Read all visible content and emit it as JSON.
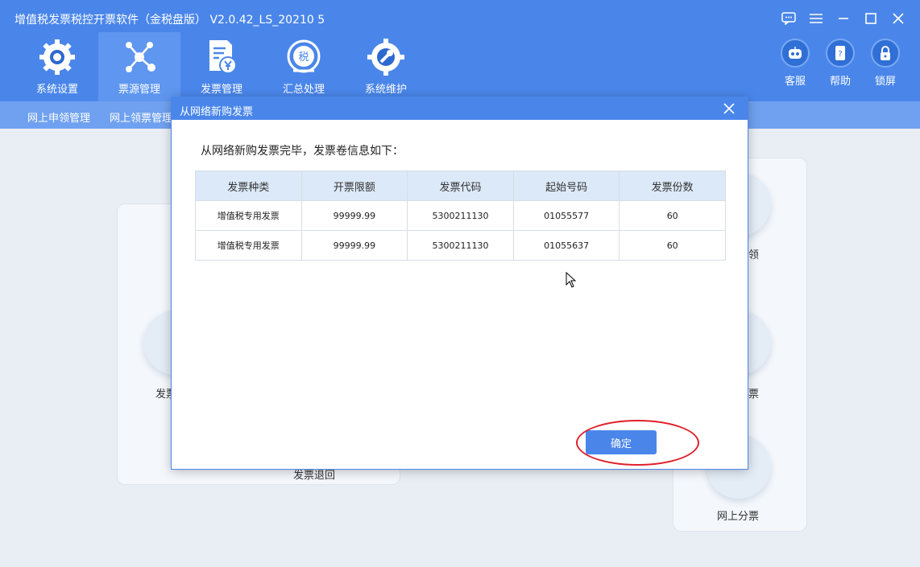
{
  "window": {
    "title": "增值税发票税控开票软件（金税盘版） V2.0.42_LS_20210 5",
    "controls": [
      "feedback-icon",
      "menu-icon",
      "minimize-icon",
      "maximize-icon",
      "close-icon"
    ]
  },
  "nav": {
    "items": [
      {
        "label": "系统设置",
        "icon": "gear-icon"
      },
      {
        "label": "票源管理",
        "icon": "network-icon",
        "active": true
      },
      {
        "label": "发票管理",
        "icon": "invoice-yen-icon"
      },
      {
        "label": "汇总处理",
        "icon": "tax-summary-icon"
      },
      {
        "label": "系统维护",
        "icon": "wrench-gear-icon"
      }
    ]
  },
  "tools": {
    "items": [
      {
        "label": "客服",
        "icon": "robot-icon"
      },
      {
        "label": "帮助",
        "icon": "help-book-icon"
      },
      {
        "label": "锁屏",
        "icon": "lock-icon"
      }
    ]
  },
  "subnav": {
    "items": [
      "网上申领管理",
      "网上领票管理"
    ]
  },
  "background": {
    "left_label_partial": "发票",
    "left_bottom_label": "发票退回",
    "right_labels": [
      "领",
      "票",
      "网上分票"
    ]
  },
  "dialog": {
    "title": "从网络新购发票",
    "message": "从网络新购发票完毕，发票卷信息如下：",
    "columns": [
      "发票种类",
      "开票限额",
      "发票代码",
      "起始号码",
      "发票份数"
    ],
    "rows": [
      [
        "增值税专用发票",
        "99999.99",
        "5300211130",
        "01055577",
        "60"
      ],
      [
        "增值税专用发票",
        "99999.99",
        "5300211130",
        "01055637",
        "60"
      ]
    ],
    "ok_label": "确定"
  },
  "colors": {
    "primary": "#4a86ea",
    "subnav": "#6fa1f0",
    "header_cell": "#dce9f8",
    "highlight_ring": "#e0202a"
  }
}
